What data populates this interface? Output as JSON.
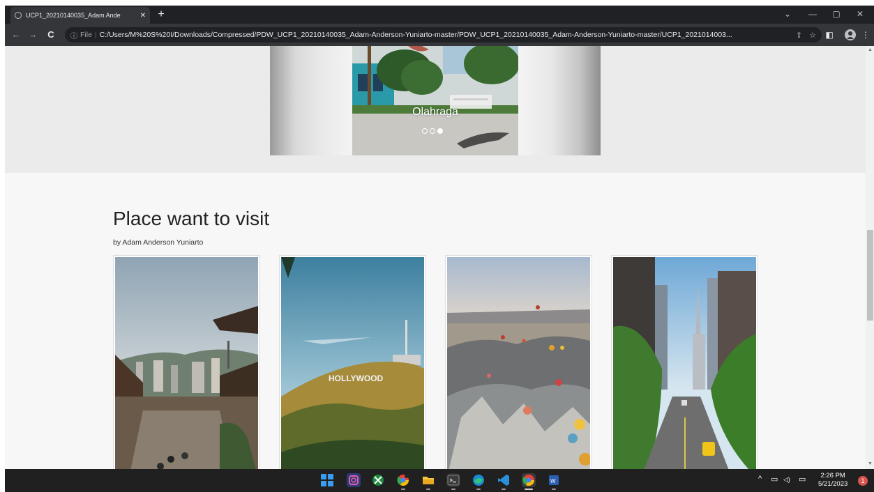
{
  "browser": {
    "tab_title": "UCP1_20210140035_Adam Ande",
    "tab_close": "✕",
    "new_tab": "+",
    "url_info_icon": "ⓘ",
    "url_scheme": "File",
    "url_separator": "|",
    "url_path": "C:/Users/M%20S%20I/Downloads/Compressed/PDW_UCP1_20210140035_Adam-Anderson-Yuniarto-master/PDW_UCP1_20210140035_Adam-Anderson-Yuniarto-master/UCP1_2021014003..."
  },
  "page": {
    "slider": {
      "caption": "Olahraga",
      "dots": 3,
      "active_dot": 3
    },
    "section_title": "Place want to visit",
    "byline": "by Adam Anderson Yuniarto",
    "cards": [
      {
        "name": "seoul-hanok-village"
      },
      {
        "name": "hollywood-hills"
      },
      {
        "name": "cappadocia-balloons"
      },
      {
        "name": "new-york-street"
      }
    ]
  },
  "icons": {
    "back": "←",
    "forward": "→",
    "reload": "C",
    "share": "⇪",
    "star": "☆",
    "sidepanel": "◧",
    "profile": "●",
    "menu": "⋮",
    "minimize": "—",
    "restore": "▢",
    "close": "✕",
    "chevron": "⌄",
    "tray_chevron": "^",
    "tray_network": "▭",
    "tray_sound": "◁)",
    "tray_battery": "▭"
  },
  "taskbar": {
    "time": "2:26 PM",
    "date": "5/21/2023",
    "notification_count": "1"
  },
  "colors": {
    "chrome_dark": "#202124",
    "chrome_toolbar": "#35363a",
    "page_bg": "#f7f7f8",
    "hero_bg": "#ebebec",
    "taskbar_bg": "#202020"
  }
}
